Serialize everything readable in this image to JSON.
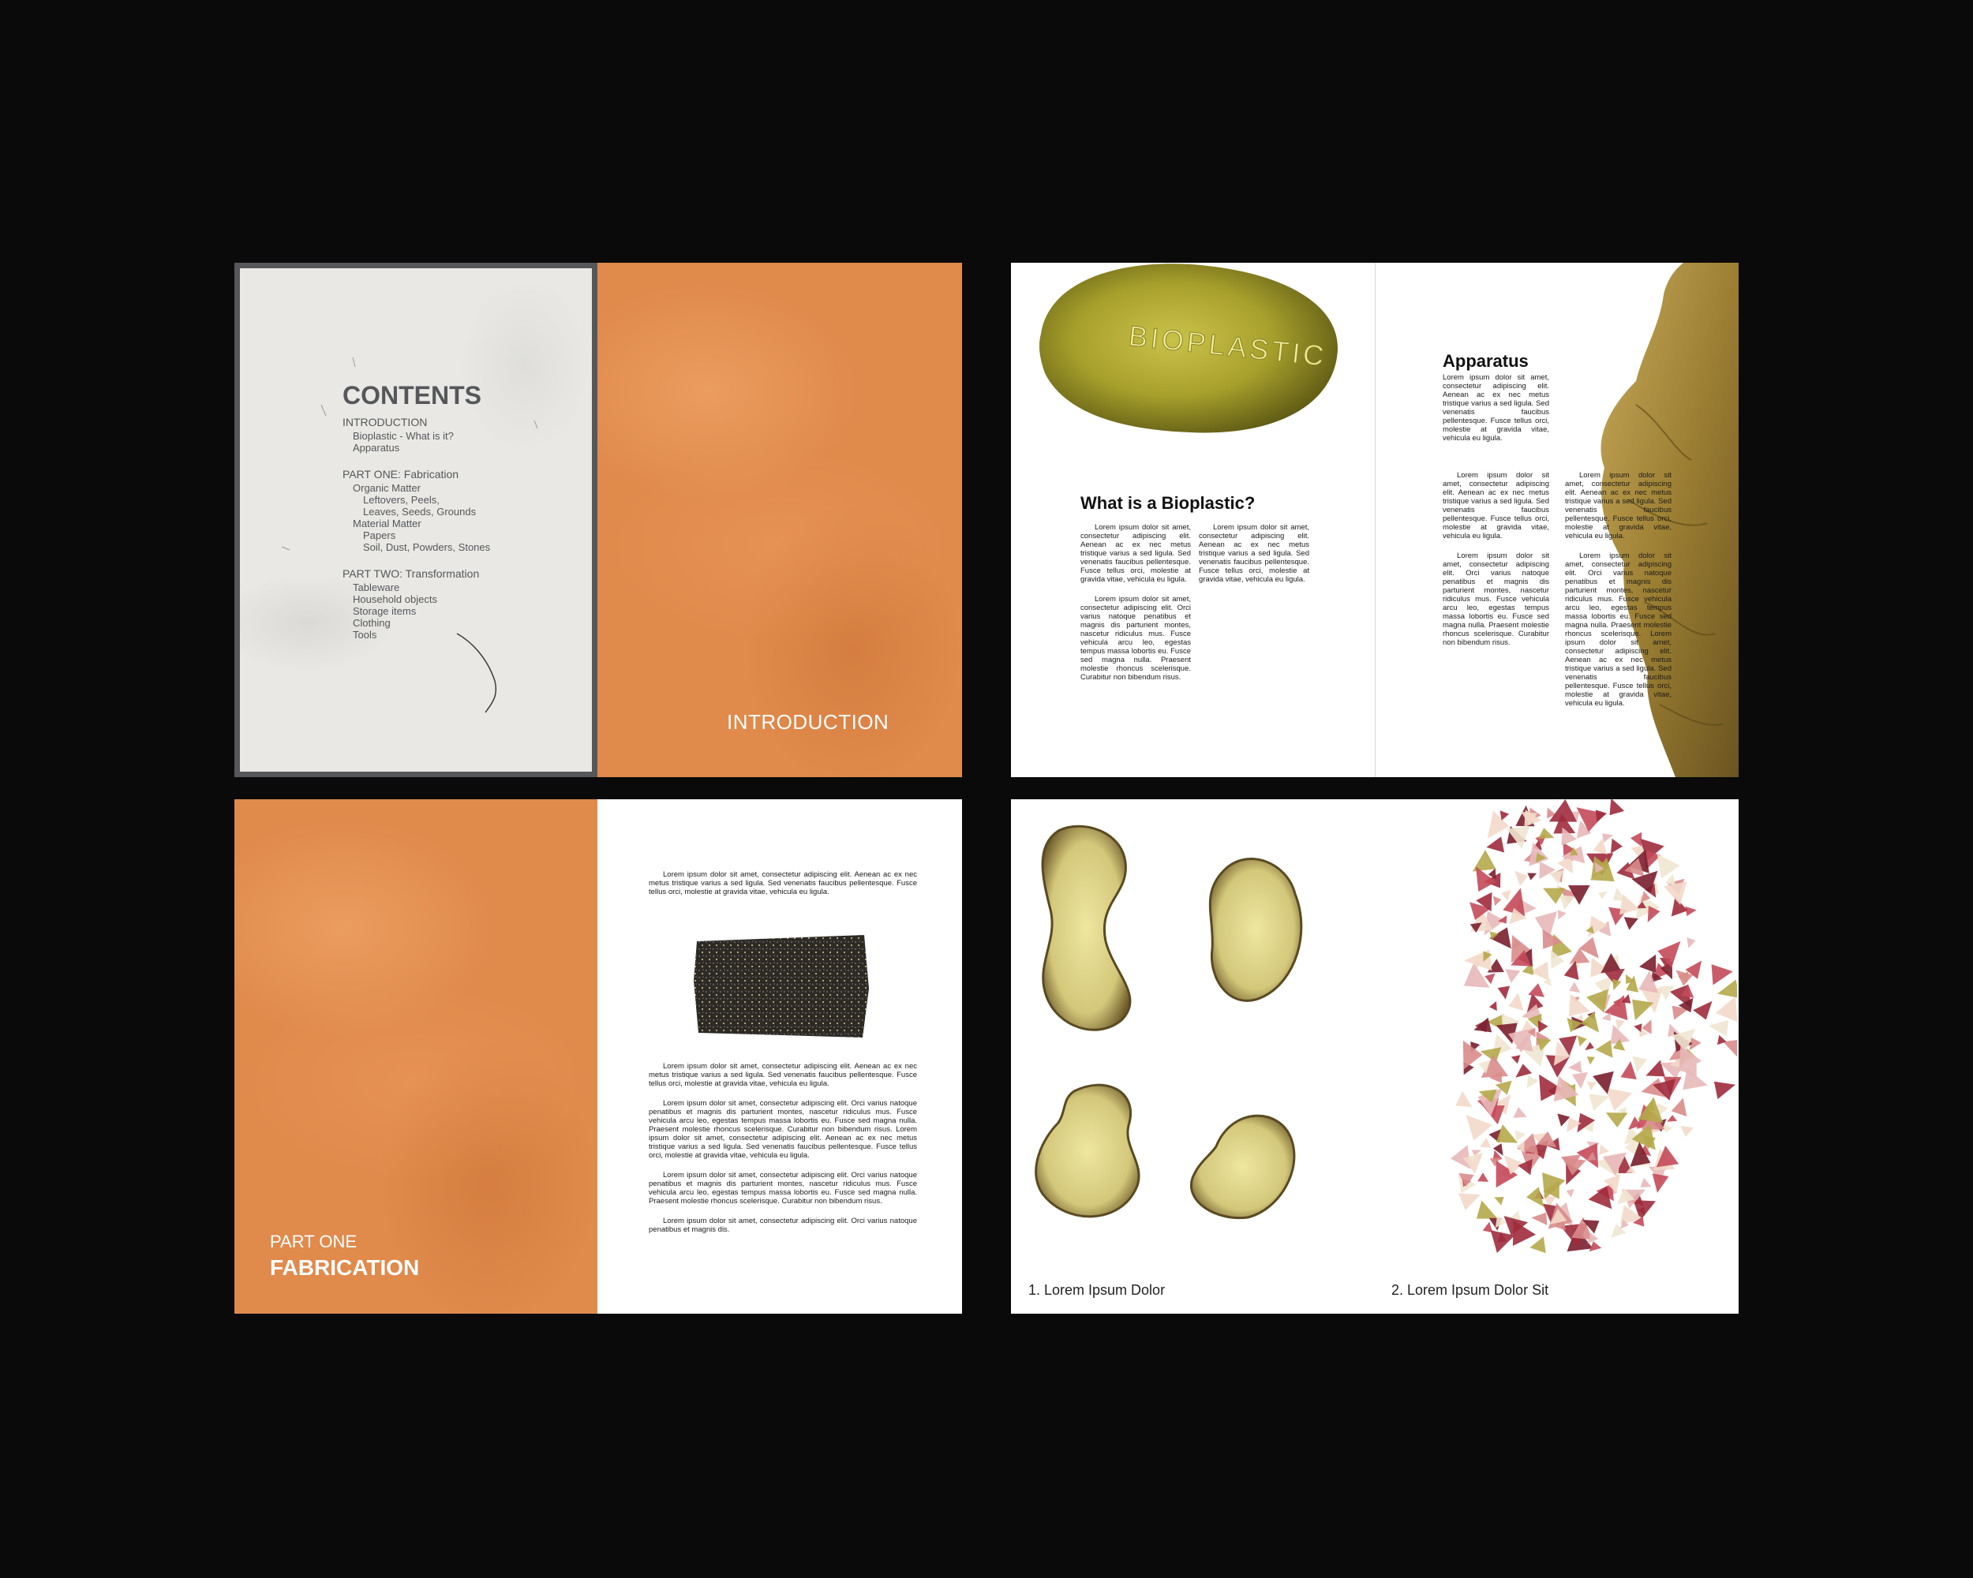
{
  "spread1": {
    "contents_title": "CONTENTS",
    "toc": [
      {
        "text": "INTRODUCTION",
        "level": 0
      },
      {
        "text": "Bioplastic - What is it?",
        "level": 1
      },
      {
        "text": "Apparatus",
        "level": 1
      },
      {
        "text": "PART ONE: Fabrication",
        "level": 0
      },
      {
        "text": "Organic Matter",
        "level": 1
      },
      {
        "text": "Leftovers, Peels,",
        "level": 2
      },
      {
        "text": "Leaves, Seeds, Grounds",
        "level": 2
      },
      {
        "text": "Material Matter",
        "level": 1
      },
      {
        "text": "Papers",
        "level": 2
      },
      {
        "text": "Soil, Dust, Powders, Stones",
        "level": 2
      },
      {
        "text": "PART TWO: Transformation",
        "level": 0
      },
      {
        "text": "Tableware",
        "level": 1
      },
      {
        "text": "Household objects",
        "level": 1
      },
      {
        "text": "Storage items",
        "level": 1
      },
      {
        "text": "Clothing",
        "level": 1
      },
      {
        "text": "Tools",
        "level": 1
      }
    ],
    "right_title": "INTRODUCTION"
  },
  "spread2": {
    "fruit_label": "BIOPLASTIC",
    "heading_left": "What is a Bioplastic?",
    "left_col1_p1": "Lorem ipsum dolor sit amet, consectetur adipiscing elit. Aenean ac ex nec metus tristique varius a sed ligula. Sed venenatis faucibus pellentesque. Fusce tellus orci, molestie at gravida vitae, vehicula eu ligula.",
    "left_col1_p2": "Lorem ipsum dolor sit amet, consectetur adipiscing elit. Orci varius natoque penatibus et magnis dis parturient montes, nascetur ridiculus mus. Fusce vehicula arcu leo, egestas tempus massa lobortis eu. Fusce sed magna nulla. Praesent molestie rhoncus scelerisque. Curabitur non bibendum risus.",
    "left_col2_p1": "Lorem ipsum dolor sit amet, consectetur adipiscing elit. Aenean ac ex nec metus tristique varius a sed ligula. Sed venenatis faucibus pellentesque. Fusce tellus orci, molestie at gravida vitae, vehicula eu ligula.",
    "heading_right": "Apparatus",
    "right_intro": "Lorem ipsum dolor sit amet, consectetur adipiscing elit. Aenean ac ex nec metus tristique varius a sed ligula. Sed venenatis faucibus pellentesque. Fusce tellus orci, molestie at gravida vitae, vehicula eu ligula.",
    "right_col1_p1": "Lorem ipsum dolor sit amet, consectetur adipiscing elit. Aenean ac ex nec metus tristique varius a sed ligula. Sed venenatis faucibus pellentesque. Fusce tellus orci, molestie at gravida vitae, vehicula eu ligula.",
    "right_col1_p2": "Lorem ipsum dolor sit amet, consectetur adipiscing elit. Orci varius natoque penatibus et magnis dis parturient montes, nascetur ridiculus mus. Fusce vehicula arcu leo, egestas tempus massa lobortis eu. Fusce sed magna nulla. Praesent molestie rhoncus scelerisque. Curabitur non bibendum risus.",
    "right_col2_p1": "Lorem ipsum dolor sit amet, consectetur adipiscing elit. Aenean ac ex nec metus tristique varius a sed ligula. Sed venenatis faucibus pellentesque. Fusce tellus orci, molestie at gravida vitae, vehicula eu ligula.",
    "right_col2_p2": "Lorem ipsum dolor sit amet, consectetur adipiscing elit. Orci varius natoque penatibus et magnis dis parturient montes, nascetur ridiculus mus. Fusce vehicula arcu leo, egestas tempus massa lobortis eu. Fusce sed magna nulla. Praesent molestie rhoncus scelerisque. Lorem ipsum dolor sit amet, consectetur adipiscing elit. Aenean ac ex nec metus tristique varius a sed ligula. Sed venenatis faucibus pellentesque. Fusce tellus orci, molestie at gravida vitae, vehicula eu ligula."
  },
  "spread3": {
    "part_label": "PART ONE",
    "part_title": "FABRICATION",
    "top_paragraph": "Lorem ipsum dolor sit amet, consectetur adipiscing elit. Aenean ac ex nec metus tristique varius a sed ligula. Sed venenatis faucibus pellentesque. Fusce tellus orci, molestie at gravida vitae, vehicula eu ligula.",
    "body_p1": "Lorem ipsum dolor sit amet, consectetur adipiscing elit. Aenean ac ex nec metus tristique varius a sed ligula. Sed venenatis faucibus pellentesque. Fusce tellus orci, molestie at gravida vitae, vehicula eu ligula.",
    "body_p2": "Lorem ipsum dolor sit amet, consectetur adipiscing elit. Orci varius natoque penatibus et magnis dis parturient montes, nascetur ridiculus mus. Fusce vehicula arcu leo, egestas tempus massa lobortis eu. Fusce sed magna nulla. Praesent molestie rhoncus scelerisque. Curabitur non bibendum risus. Lorem ipsum dolor sit amet, consectetur adipiscing elit. Aenean ac ex nec metus tristique varius a sed ligula. Sed venenatis faucibus pellentesque. Fusce tellus orci, molestie at gravida vitae, vehicula eu ligula.",
    "body_p3": "Lorem ipsum dolor sit amet, consectetur adipiscing elit. Orci varius natoque penatibus et magnis dis parturient montes, nascetur ridiculus mus. Fusce vehicula arcu leo, egestas tempus massa lobortis eu. Fusce sed magna nulla. Praesent molestie rhoncus scelerisque. Curabitur non bibendum risus.",
    "body_p4": "Lorem ipsum dolor sit amet, consectetur adipiscing elit. Orci varius natoque penatibus et magnis dis."
  },
  "spread4": {
    "caption_left": "1. Lorem Ipsum Dolor",
    "caption_right": "2. Lorem Ipsum Dolor Sit"
  },
  "colors": {
    "background": "#0a0a0a",
    "orange_page": "#e08a4c",
    "toc_text": "#55575a",
    "white_page": "#ffffff"
  }
}
